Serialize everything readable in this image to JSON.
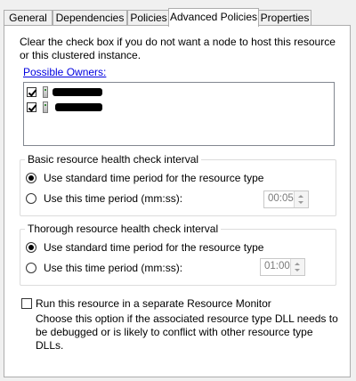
{
  "tabs": [
    {
      "label": "General",
      "active": false
    },
    {
      "label": "Dependencies",
      "active": false
    },
    {
      "label": "Policies",
      "active": false
    },
    {
      "label": "Advanced Policies",
      "active": true
    },
    {
      "label": "Properties",
      "active": false
    }
  ],
  "intro_text": "Clear the check box if you do not want a node to host this resource or this clustered instance.",
  "possible_owners": {
    "link_label": "Possible Owners:",
    "items": [
      {
        "checked": true,
        "name_redacted": true
      },
      {
        "checked": true,
        "name_redacted": true
      }
    ]
  },
  "basic_check": {
    "legend": "Basic resource health check interval",
    "option_standard": "Use standard time period for the resource type",
    "option_custom": "Use this time period (mm:ss):",
    "selected": "standard",
    "time_value": "00:05"
  },
  "thorough_check": {
    "legend": "Thorough resource health check interval",
    "option_standard": "Use standard time period for the resource type",
    "option_custom": "Use this time period (mm:ss):",
    "selected": "standard",
    "time_value": "01:00"
  },
  "separate_monitor": {
    "label": "Run this resource in a separate Resource Monitor",
    "checked": false,
    "description": "Choose this option if the associated resource type DLL needs to be debugged or is likely to conflict with other resource type DLLs."
  }
}
